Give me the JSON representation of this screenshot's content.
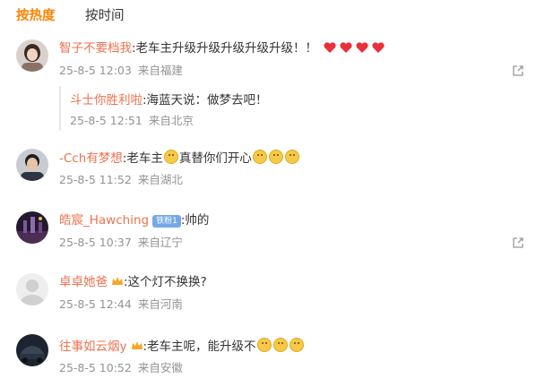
{
  "tabs": {
    "hot": "按热度",
    "time": "按时间"
  },
  "comments": [
    {
      "user": "智子不要档我",
      "text": ":老车主升级升级升级升级升级！！",
      "date": "25-8-5 12:03",
      "location": "来自福建",
      "reply": {
        "user": "斗士你胜利啦",
        "text": ":海蓝天说：做梦去吧！",
        "date": "25-8-5 12:51",
        "location": "来自北京"
      }
    },
    {
      "user": "-Cch有梦想",
      "text_a": ":老车主",
      "text_b": "真替你们开心",
      "date": "25-8-5 11:52",
      "location": "来自湖北"
    },
    {
      "user": "皓宸_Hawching",
      "vip": "铁粉1",
      "text": ":帅的",
      "date": "25-8-5 10:37",
      "location": "来自辽宁"
    },
    {
      "user": "卓卓她爸",
      "text": ":这个灯不换换?",
      "date": "25-8-5 12:44",
      "location": "来自河南"
    },
    {
      "user": "往事如云烟y",
      "text": ":老车主呢，能升级不",
      "date": "25-8-5 10:52",
      "location": "来自安徽"
    }
  ]
}
